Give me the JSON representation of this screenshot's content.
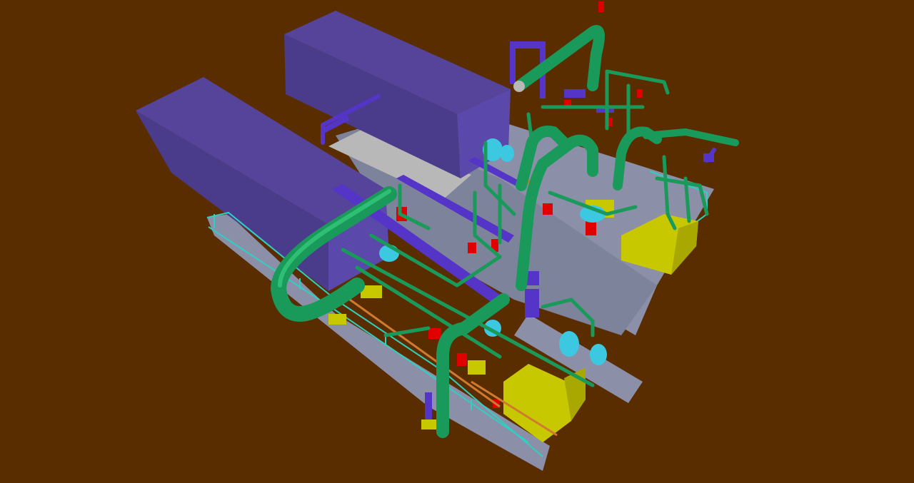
{
  "viewport": {
    "background": "#5a2d00",
    "scene": "3d-plant-model"
  },
  "palette": {
    "building_top": "#55449a",
    "building_side": "#4a3c8a",
    "building_front": "#5a49aa",
    "pipe": "#1a9a5a",
    "pipe_light": "#2fbf74",
    "steel": "#5535c8",
    "floor": "#8b8fa8",
    "floor_dark": "#6f7390",
    "grating": "#b8b8b8",
    "equipment_yellow": "#c8c800",
    "equipment_red": "#e00000",
    "railing": "#2fd0c0",
    "vessel_cyan": "#3cc8e0",
    "beam_orange": "#d07a30"
  },
  "objects": {
    "buildings": [
      "building-block-left",
      "building-block-right"
    ],
    "equipment": [
      "skid-west",
      "skid-east",
      "generator-yellow-front",
      "generator-yellow-rear",
      "vessel-pair"
    ],
    "piping": [
      "main-pipe-rack",
      "riser-loop",
      "branch-lines"
    ]
  }
}
